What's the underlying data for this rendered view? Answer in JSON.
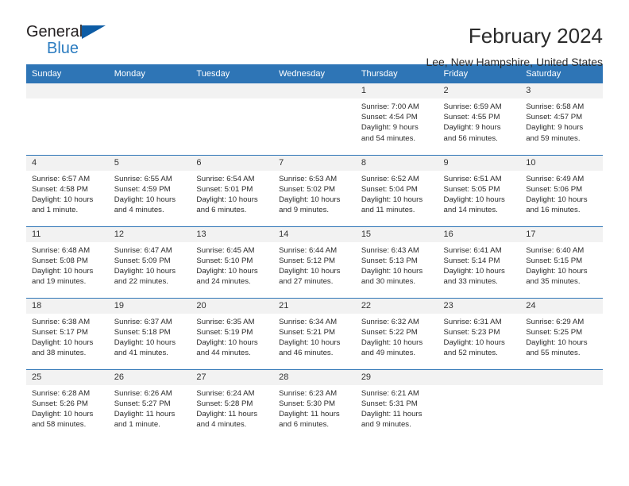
{
  "brand": {
    "name_top": "General",
    "name_bottom": "Blue",
    "accent_color": "#2b7cc0",
    "triangle_color": "#0d5ca5",
    "triangle_icon": "triangle-icon"
  },
  "header": {
    "title": "February 2024",
    "subtitle": "Lee, New Hampshire, United States"
  },
  "calendar": {
    "header_background": "#2e75b6",
    "daynum_background": "#f2f2f2",
    "weekdays": [
      "Sunday",
      "Monday",
      "Tuesday",
      "Wednesday",
      "Thursday",
      "Friday",
      "Saturday"
    ],
    "weeks": [
      [
        {
          "day": "",
          "sunrise": "",
          "sunset": "",
          "daylight": ""
        },
        {
          "day": "",
          "sunrise": "",
          "sunset": "",
          "daylight": ""
        },
        {
          "day": "",
          "sunrise": "",
          "sunset": "",
          "daylight": ""
        },
        {
          "day": "",
          "sunrise": "",
          "sunset": "",
          "daylight": ""
        },
        {
          "day": "1",
          "sunrise": "Sunrise: 7:00 AM",
          "sunset": "Sunset: 4:54 PM",
          "daylight": "Daylight: 9 hours and 54 minutes."
        },
        {
          "day": "2",
          "sunrise": "Sunrise: 6:59 AM",
          "sunset": "Sunset: 4:55 PM",
          "daylight": "Daylight: 9 hours and 56 minutes."
        },
        {
          "day": "3",
          "sunrise": "Sunrise: 6:58 AM",
          "sunset": "Sunset: 4:57 PM",
          "daylight": "Daylight: 9 hours and 59 minutes."
        }
      ],
      [
        {
          "day": "4",
          "sunrise": "Sunrise: 6:57 AM",
          "sunset": "Sunset: 4:58 PM",
          "daylight": "Daylight: 10 hours and 1 minute."
        },
        {
          "day": "5",
          "sunrise": "Sunrise: 6:55 AM",
          "sunset": "Sunset: 4:59 PM",
          "daylight": "Daylight: 10 hours and 4 minutes."
        },
        {
          "day": "6",
          "sunrise": "Sunrise: 6:54 AM",
          "sunset": "Sunset: 5:01 PM",
          "daylight": "Daylight: 10 hours and 6 minutes."
        },
        {
          "day": "7",
          "sunrise": "Sunrise: 6:53 AM",
          "sunset": "Sunset: 5:02 PM",
          "daylight": "Daylight: 10 hours and 9 minutes."
        },
        {
          "day": "8",
          "sunrise": "Sunrise: 6:52 AM",
          "sunset": "Sunset: 5:04 PM",
          "daylight": "Daylight: 10 hours and 11 minutes."
        },
        {
          "day": "9",
          "sunrise": "Sunrise: 6:51 AM",
          "sunset": "Sunset: 5:05 PM",
          "daylight": "Daylight: 10 hours and 14 minutes."
        },
        {
          "day": "10",
          "sunrise": "Sunrise: 6:49 AM",
          "sunset": "Sunset: 5:06 PM",
          "daylight": "Daylight: 10 hours and 16 minutes."
        }
      ],
      [
        {
          "day": "11",
          "sunrise": "Sunrise: 6:48 AM",
          "sunset": "Sunset: 5:08 PM",
          "daylight": "Daylight: 10 hours and 19 minutes."
        },
        {
          "day": "12",
          "sunrise": "Sunrise: 6:47 AM",
          "sunset": "Sunset: 5:09 PM",
          "daylight": "Daylight: 10 hours and 22 minutes."
        },
        {
          "day": "13",
          "sunrise": "Sunrise: 6:45 AM",
          "sunset": "Sunset: 5:10 PM",
          "daylight": "Daylight: 10 hours and 24 minutes."
        },
        {
          "day": "14",
          "sunrise": "Sunrise: 6:44 AM",
          "sunset": "Sunset: 5:12 PM",
          "daylight": "Daylight: 10 hours and 27 minutes."
        },
        {
          "day": "15",
          "sunrise": "Sunrise: 6:43 AM",
          "sunset": "Sunset: 5:13 PM",
          "daylight": "Daylight: 10 hours and 30 minutes."
        },
        {
          "day": "16",
          "sunrise": "Sunrise: 6:41 AM",
          "sunset": "Sunset: 5:14 PM",
          "daylight": "Daylight: 10 hours and 33 minutes."
        },
        {
          "day": "17",
          "sunrise": "Sunrise: 6:40 AM",
          "sunset": "Sunset: 5:15 PM",
          "daylight": "Daylight: 10 hours and 35 minutes."
        }
      ],
      [
        {
          "day": "18",
          "sunrise": "Sunrise: 6:38 AM",
          "sunset": "Sunset: 5:17 PM",
          "daylight": "Daylight: 10 hours and 38 minutes."
        },
        {
          "day": "19",
          "sunrise": "Sunrise: 6:37 AM",
          "sunset": "Sunset: 5:18 PM",
          "daylight": "Daylight: 10 hours and 41 minutes."
        },
        {
          "day": "20",
          "sunrise": "Sunrise: 6:35 AM",
          "sunset": "Sunset: 5:19 PM",
          "daylight": "Daylight: 10 hours and 44 minutes."
        },
        {
          "day": "21",
          "sunrise": "Sunrise: 6:34 AM",
          "sunset": "Sunset: 5:21 PM",
          "daylight": "Daylight: 10 hours and 46 minutes."
        },
        {
          "day": "22",
          "sunrise": "Sunrise: 6:32 AM",
          "sunset": "Sunset: 5:22 PM",
          "daylight": "Daylight: 10 hours and 49 minutes."
        },
        {
          "day": "23",
          "sunrise": "Sunrise: 6:31 AM",
          "sunset": "Sunset: 5:23 PM",
          "daylight": "Daylight: 10 hours and 52 minutes."
        },
        {
          "day": "24",
          "sunrise": "Sunrise: 6:29 AM",
          "sunset": "Sunset: 5:25 PM",
          "daylight": "Daylight: 10 hours and 55 minutes."
        }
      ],
      [
        {
          "day": "25",
          "sunrise": "Sunrise: 6:28 AM",
          "sunset": "Sunset: 5:26 PM",
          "daylight": "Daylight: 10 hours and 58 minutes."
        },
        {
          "day": "26",
          "sunrise": "Sunrise: 6:26 AM",
          "sunset": "Sunset: 5:27 PM",
          "daylight": "Daylight: 11 hours and 1 minute."
        },
        {
          "day": "27",
          "sunrise": "Sunrise: 6:24 AM",
          "sunset": "Sunset: 5:28 PM",
          "daylight": "Daylight: 11 hours and 4 minutes."
        },
        {
          "day": "28",
          "sunrise": "Sunrise: 6:23 AM",
          "sunset": "Sunset: 5:30 PM",
          "daylight": "Daylight: 11 hours and 6 minutes."
        },
        {
          "day": "29",
          "sunrise": "Sunrise: 6:21 AM",
          "sunset": "Sunset: 5:31 PM",
          "daylight": "Daylight: 11 hours and 9 minutes."
        },
        {
          "day": "",
          "sunrise": "",
          "sunset": "",
          "daylight": ""
        },
        {
          "day": "",
          "sunrise": "",
          "sunset": "",
          "daylight": ""
        }
      ]
    ]
  }
}
